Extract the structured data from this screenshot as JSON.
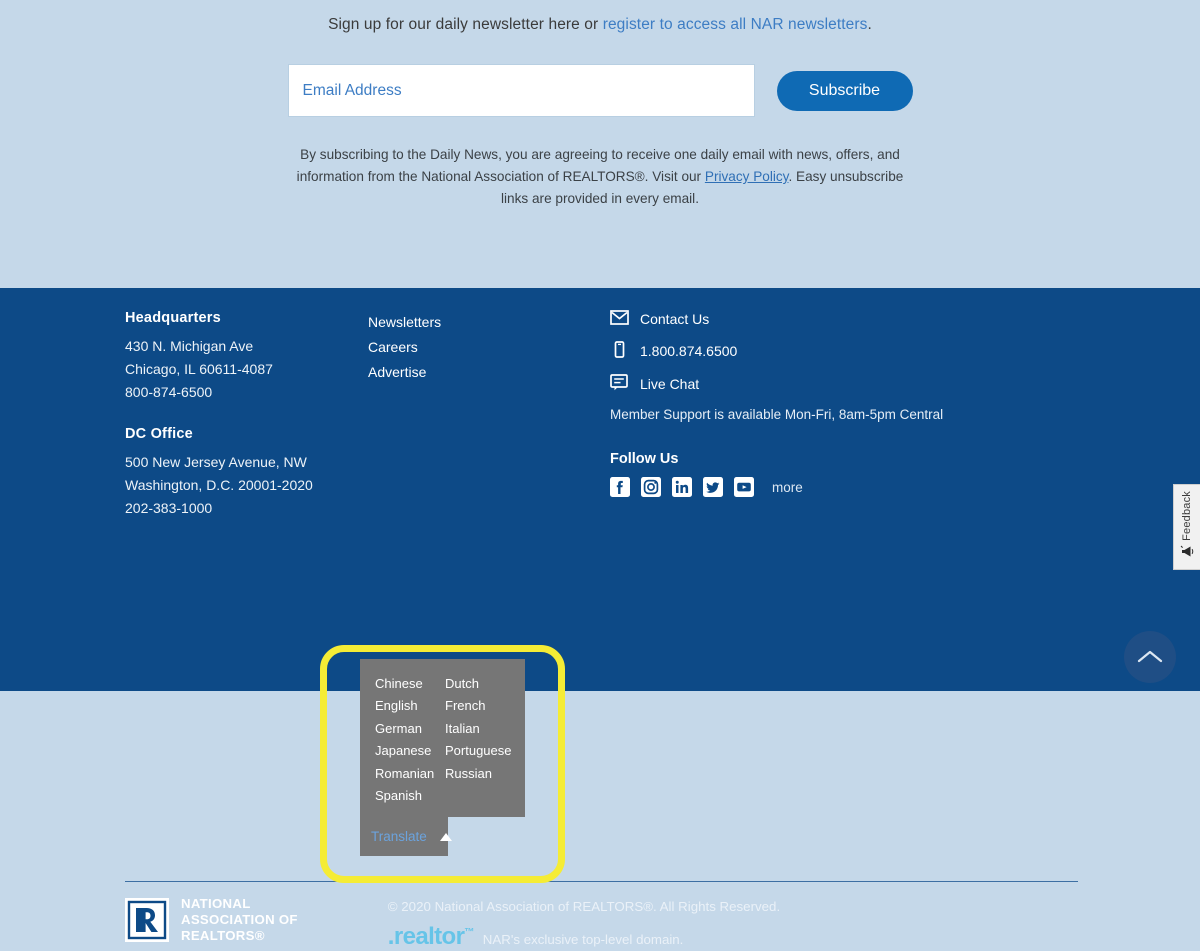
{
  "signup": {
    "prompt_prefix": "Sign up for our daily newsletter here or ",
    "prompt_link": "register to access all NAR newsletters",
    "prompt_suffix": ".",
    "email_placeholder": "Email Address",
    "email_value": "",
    "subscribe_label": "Subscribe",
    "disclaimer_part1": "By subscribing to the Daily News, you are agreeing to receive one daily email with news, offers, and information from the National Association of REALTORS®. Visit our ",
    "disclaimer_link": "Privacy Policy",
    "disclaimer_part2": ". Easy unsubscribe links are provided in every email."
  },
  "footer": {
    "headquarters": {
      "title": "Headquarters",
      "lines": [
        "430 N. Michigan Ave",
        "Chicago, IL 60611-4087",
        "800-874-6500"
      ]
    },
    "dc_office": {
      "title": "DC Office",
      "lines": [
        "500 New Jersey Avenue, NW",
        "Washington, D.C. 20001-2020",
        "202-383-1000"
      ]
    },
    "links": [
      {
        "label": "Newsletters",
        "icon": ""
      },
      {
        "label": "Careers",
        "icon": ""
      },
      {
        "label": "Advertise",
        "icon": ""
      }
    ],
    "contact": [
      {
        "label": "Contact Us",
        "icon": "envelope-icon"
      },
      {
        "label": "1.800.874.6500",
        "icon": "mobile-phone-icon"
      },
      {
        "label": "Live Chat",
        "icon": "chat-bubble-icon"
      }
    ],
    "support_note": "Member Support is available Mon-Fri, 8am-5pm Central",
    "follow_us_title": "Follow Us",
    "social": [
      {
        "name": "facebook-icon"
      },
      {
        "name": "instagram-icon"
      },
      {
        "name": "linkedin-icon"
      },
      {
        "name": "twitter-icon"
      },
      {
        "name": "youtube-icon"
      }
    ],
    "more_label": "more"
  },
  "translate": {
    "toggle_label": "Translate",
    "caret": "caret-up-icon",
    "expanded": true,
    "languages": [
      "Chinese",
      "Dutch",
      "English",
      "French",
      "German",
      "Italian",
      "Japanese",
      "Portuguese",
      "Romanian",
      "Russian",
      "Spanish"
    ]
  },
  "bottom": {
    "logo_lines": [
      "NATIONAL",
      "ASSOCIATION OF",
      "REALTORS®"
    ],
    "copyright": "© 2020 National Association of REALTORS®. All Rights Reserved.",
    "realtor_logo": ".realtor",
    "realtor_tm": "™",
    "realtor_tagline": "NAR's exclusive top-level domain."
  },
  "feedback": {
    "label": "Feedback",
    "icon": "megaphone-icon"
  },
  "to_top": {
    "icon": "chevron-up-icon"
  },
  "colors": {
    "page_light_blue": "#c5d8e9",
    "footer_navy": "#0d4a87",
    "accent_blue": "#0f6ab4",
    "link_blue": "#3d7dc4",
    "highlight_yellow": "#f5ec35",
    "panel_gray": "#767676",
    "realtor_cyan": "#66c4e8"
  }
}
